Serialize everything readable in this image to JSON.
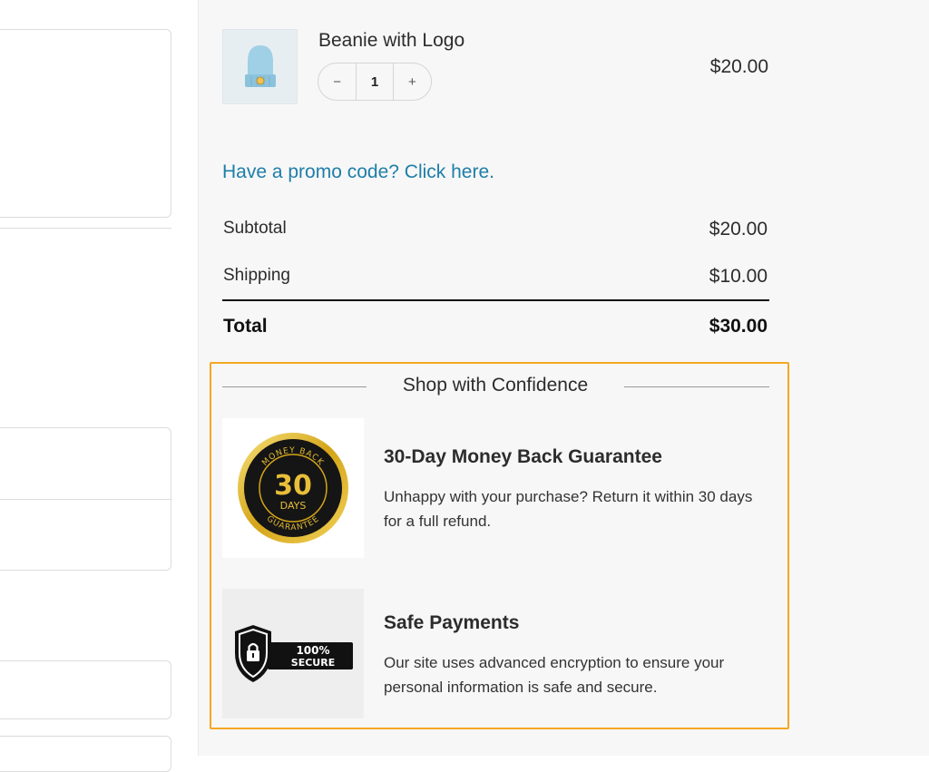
{
  "cart": {
    "item": {
      "name": "Beanie with Logo",
      "quantity": "1",
      "decrement_label": "−",
      "increment_label": "+",
      "price": "$20.00",
      "thumbnail_icon": "beanie-icon"
    },
    "promo_link": "Have a promo code? Click here.",
    "subtotal_label": "Subtotal",
    "subtotal_value": "$20.00",
    "shipping_label": "Shipping",
    "shipping_value": "$10.00",
    "total_label": "Total",
    "total_value": "$30.00"
  },
  "confidence": {
    "heading": "Shop with Confidence",
    "accent_color": "#f5a623",
    "features": [
      {
        "title": "30-Day Money Back Guarantee",
        "text": "Unhappy with your purchase? Return it within 30 days for a full refund.",
        "badge": {
          "icon": "money-back-badge-icon",
          "top_text": "MONEY BACK",
          "number": "30",
          "unit": "DAYS",
          "bottom_text": "GUARANTEE"
        }
      },
      {
        "title": "Safe Payments",
        "text": "Our site uses advanced encryption to ensure your personal information is safe and secure.",
        "badge": {
          "icon": "secure-shield-icon",
          "line1": "100%",
          "line2": "SECURE"
        }
      }
    ]
  }
}
